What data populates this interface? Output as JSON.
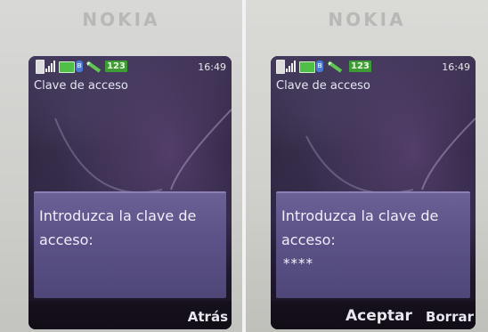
{
  "photos": [
    {
      "brand": "NOKIA",
      "status": {
        "numeric_mode": "123",
        "time": "16:49"
      },
      "title": "Clave de acceso",
      "dialog": {
        "prompt": "Introduzca la clave de acceso:",
        "entered_code": ""
      },
      "softkeys": {
        "left": "",
        "center": "",
        "right": "Atrás"
      }
    },
    {
      "brand": "NOKIA",
      "status": {
        "numeric_mode": "123",
        "time": "16:49"
      },
      "title": "Clave de acceso",
      "dialog": {
        "prompt": "Introduzca la clave de acceso:",
        "entered_code": "****"
      },
      "softkeys": {
        "left": "",
        "center": "Aceptar",
        "right": "Borrar"
      }
    }
  ],
  "icons": [
    "battery-icon",
    "signal-strength-icon",
    "message-icon",
    "bluetooth-icon",
    "pen-input-icon"
  ],
  "colors": {
    "dialog": "#5d5388",
    "numeric_badge": "#3e9c34",
    "bluetooth": "#4a7ad8"
  }
}
